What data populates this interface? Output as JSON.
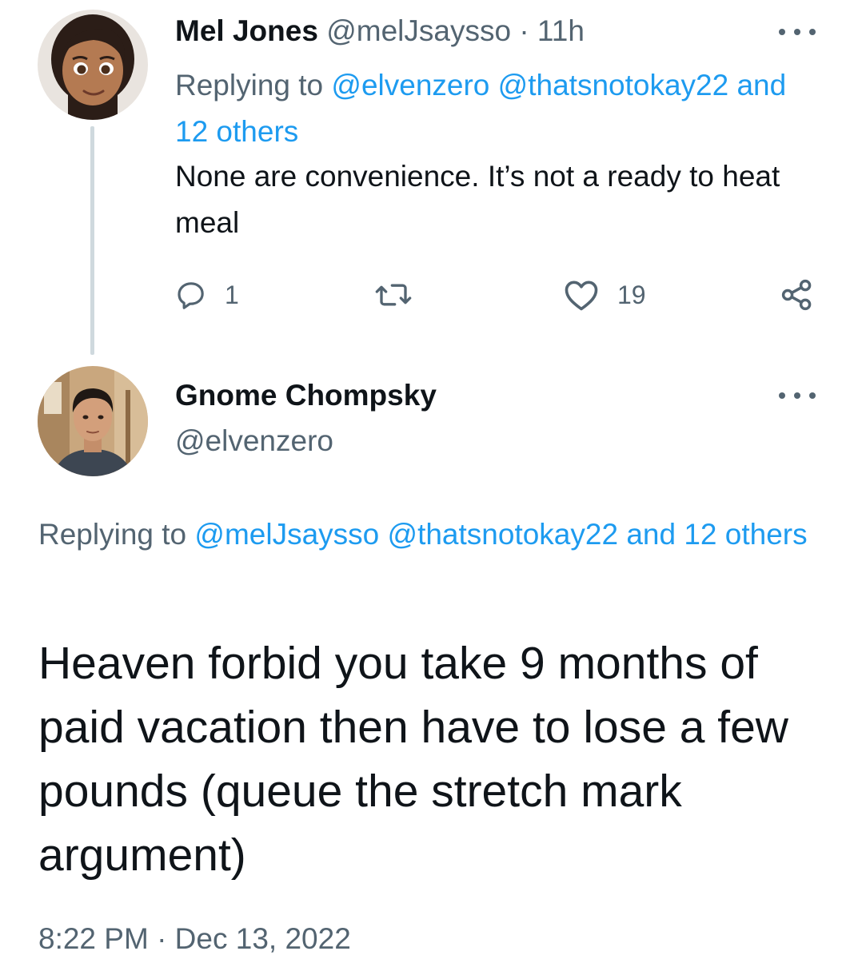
{
  "reply_tweet": {
    "author_name": "Mel Jones",
    "author_handle": "@melJsaysso",
    "separator": "·",
    "time_ago": "11h",
    "replying_prefix": "Replying to",
    "mention_1": "@elvenzero",
    "mention_2": "@thatsnotokay22",
    "mention_more": "and 12 others",
    "text": "None are convenience. It’s not a ready to heat meal",
    "reply_count": "1",
    "like_count": "19"
  },
  "main_tweet": {
    "author_name": "Gnome Chompsky",
    "author_handle": "@elvenzero",
    "replying_prefix": "Replying to",
    "mention_1": "@melJsaysso",
    "mention_2": "@thatsnotokay22",
    "mention_more": "and 12 others",
    "text": "Heaven forbid you take 9 months of paid vacation then have to lose a few pounds (queue the stretch mark argument)",
    "timestamp": "8:22 PM · Dec 13, 2022"
  },
  "icons": {
    "reply": "reply-icon",
    "retweet": "retweet-icon",
    "like": "heart-icon",
    "share": "share-icon",
    "more": "more-options-icon"
  },
  "colors": {
    "link": "#1d9bf0",
    "muted": "#536471",
    "text": "#0f1419",
    "thread_line": "#cfd9de"
  }
}
